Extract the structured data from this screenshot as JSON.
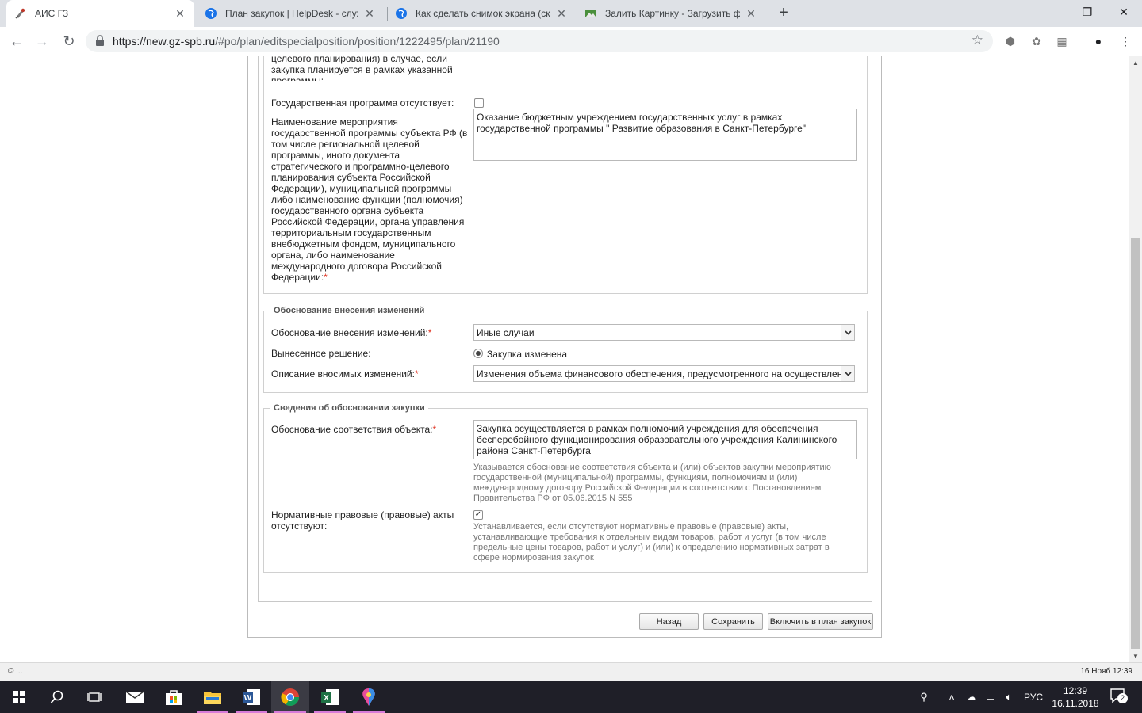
{
  "browser": {
    "tabs": [
      {
        "title": "АИС ГЗ",
        "active": true
      },
      {
        "title": "План закупок | HelpDesk - служ",
        "active": false
      },
      {
        "title": "Как сделать снимок экрана (скр",
        "active": false
      },
      {
        "title": "Залить Картинку - Загрузить фо",
        "active": false
      }
    ],
    "url_host": "https://new.gz-spb.ru",
    "url_path": "/#po/plan/editspecialposition/position/1222495/plan/21190"
  },
  "form": {
    "top_label_partial": "бюджетной целевой программы, иного документа стратегического и программно-целевого планирования) в случае, если закупка планируется в рамках указанной программы:",
    "no_program_label": "Государственная программа отсутствует:",
    "event_name_label": "Наименование мероприятия государственной программы субъекта РФ (в том числе региональной целевой программы, иного документа стратегического и программно-целевого планирования субъекта Российской Федерации), муниципальной программы либо наименование функции (полномочия) государственного органа субъекта Российской Федерации, органа управления территориальным государственным внебюджетным фондом, муниципального органа, либо наименование международного договора Российской Федерации:",
    "event_name_value": "Оказание бюджетным учреждением государственных услуг в рамках государственной программы \" Развитие образования в Санкт-Петербурге\"",
    "changes": {
      "legend": "Обоснование внесения изменений",
      "reason_label": "Обоснование внесения изменений:",
      "reason_value": "Иные случаи",
      "decision_label": "Вынесенное решение:",
      "decision_value": "Закупка изменена",
      "description_label": "Описание вносимых изменений:",
      "description_value": "Изменения объема финансового обеспечения, предусмотренного на осуществлен"
    },
    "justification": {
      "legend": "Сведения об обосновании закупки",
      "conformity_label": "Обоснование соответствия объекта:",
      "conformity_value": "Закупка осуществляется в рамках полномочий учреждения для обеспечения бесперебойного функционирования образовательного учреждения Калининского района Санкт-Петербурга",
      "conformity_hint": "Указывается обоснование соответствия объекта и (или) объектов закупки мероприятию государственной (муниципальной) программы, функциям, полномочиям и (или) международному договору Российской Федерации в соответствии с Постановлением Правительства РФ от 05.06.2015 N 555",
      "no_acts_label": "Нормативные правовые (правовые) акты отсутствуют:",
      "no_acts_hint": "Устанавливается, если отсутствуют нормативные правовые (правовые) акты, устанавливающие требования к отдельным видам товаров, работ и услуг (в том числе предельные цены товаров, работ и услуг) и (или) к определению нормативных затрат в сфере нормирования закупок"
    },
    "required_mark": "*",
    "buttons": {
      "back": "Назад",
      "save": "Сохранить",
      "include": "Включить в план закупок"
    }
  },
  "statusbar": {
    "left": "© ...",
    "right": "16 Нояб 12:39"
  },
  "taskbar": {
    "lang": "РУС",
    "time": "12:39",
    "date": "16.11.2018",
    "notifications": "2"
  },
  "colors": {
    "required": "#e0301e",
    "taskbar": "#1f1f28",
    "tabstrip": "#dee1e6"
  }
}
